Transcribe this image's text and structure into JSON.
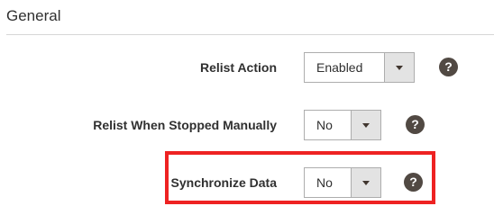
{
  "section": {
    "title": "General"
  },
  "fields": [
    {
      "label": "Relist Action",
      "value": "Enabled",
      "help": "?"
    },
    {
      "label": "Relist When Stopped Manually",
      "value": "No",
      "help": "?"
    },
    {
      "label": "Synchronize Data",
      "value": "No",
      "help": "?"
    }
  ],
  "colors": {
    "highlight_border": "#ee2222",
    "help_icon_bg": "#514943"
  }
}
